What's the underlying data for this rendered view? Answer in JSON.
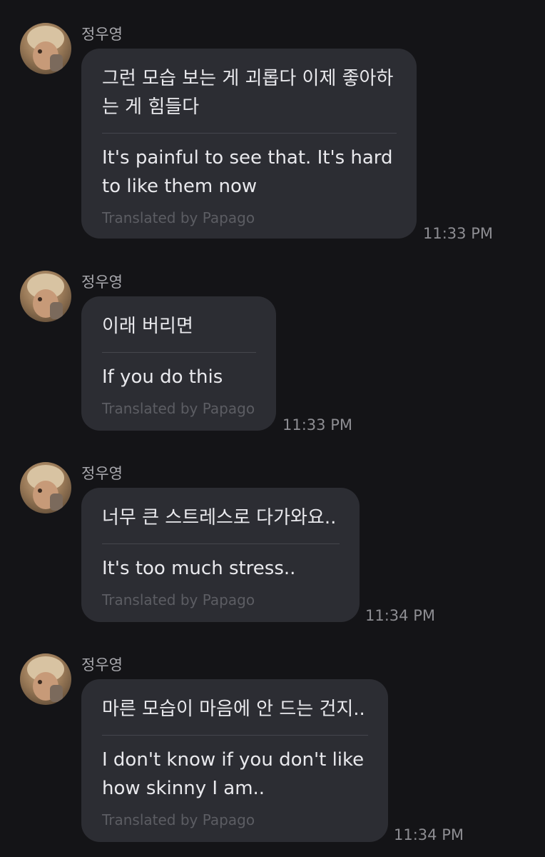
{
  "messages": [
    {
      "sender": "정우영",
      "original": "그런 모습 보는 게 괴롭다 이제 좋아하는 게 힘들다",
      "original_lines": [
        "그런 모습 보는 게 괴롭다 이제 좋아하",
        "는 게 힘들다"
      ],
      "translation_lines": [
        "It's painful to see that. It's hard",
        "to like them now"
      ],
      "credit": "Translated by Papago",
      "time": "11:33 PM"
    },
    {
      "sender": "정우영",
      "original_lines": [
        "이래 버리면"
      ],
      "translation_lines": [
        "If you do this"
      ],
      "credit": "Translated by Papago",
      "time": "11:33 PM"
    },
    {
      "sender": "정우영",
      "original_lines": [
        "너무 큰 스트레스로 다가와요.."
      ],
      "translation_lines": [
        "It's too much stress.."
      ],
      "credit": "Translated by Papago",
      "time": "11:34 PM"
    },
    {
      "sender": "정우영",
      "original_lines": [
        "마른 모습이 마음에 안 드는 건지.."
      ],
      "translation_lines": [
        "I don't know if you don't like",
        "how skinny I am.."
      ],
      "credit": "Translated by Papago",
      "time": "11:34 PM"
    }
  ]
}
